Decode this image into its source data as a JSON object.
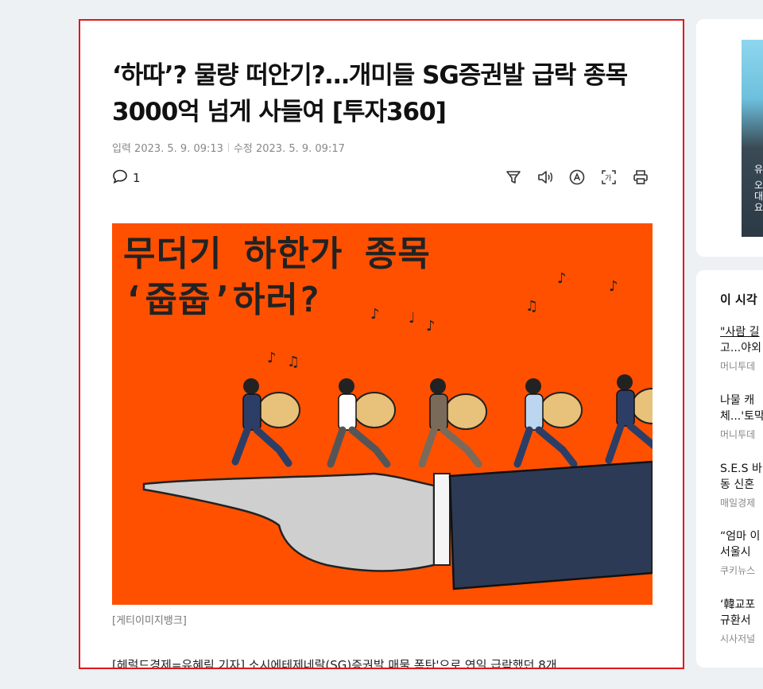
{
  "article": {
    "headline_line1": "‘하따’? 물량 떠안기?…개미들 SG증권발 급락 종목",
    "headline_line2": "3000억 넘게 사들여 [투자360]",
    "input_date": "입력 2023. 5. 9. 09:13",
    "modified_date": "수정 2023. 5. 9. 09:17",
    "comment_count": "1",
    "toolbar_icons": [
      "filter-icon",
      "speaker-icon",
      "translate-icon",
      "font-size-icon",
      "print-icon"
    ],
    "hero_text_line1": "무더기 하한가 종목",
    "hero_text_line2": "‘줍줍’하러?",
    "caption": "[게티이미지뱅크]",
    "body_start": "[헤럴드경제=유혜림 기자] 소시에테제네랄(SG)증권발 매물 폭탄'으로 연일 급락했던 8개"
  },
  "colors": {
    "hero_bg": "#ff5000",
    "highlight_border": "#e0161e"
  },
  "sidebar": {
    "video_text": [
      "유",
      "오",
      "대",
      "요"
    ],
    "section_title": "이 시각",
    "items": [
      {
        "line1": "\"사람 길",
        "line2": "고...야외",
        "source": "머니투데"
      },
      {
        "line1": "나물 캐",
        "line2": "체...'토막",
        "source": "머니투데"
      },
      {
        "line1": "S.E.S 바",
        "line2": "동 신혼",
        "source": "매일경제"
      },
      {
        "line1": "“엄마 이",
        "line2": "서울시",
        "source": "쿠키뉴스"
      },
      {
        "line1": "‘韓교포",
        "line2": "규환서",
        "source": "시사저널"
      }
    ]
  }
}
